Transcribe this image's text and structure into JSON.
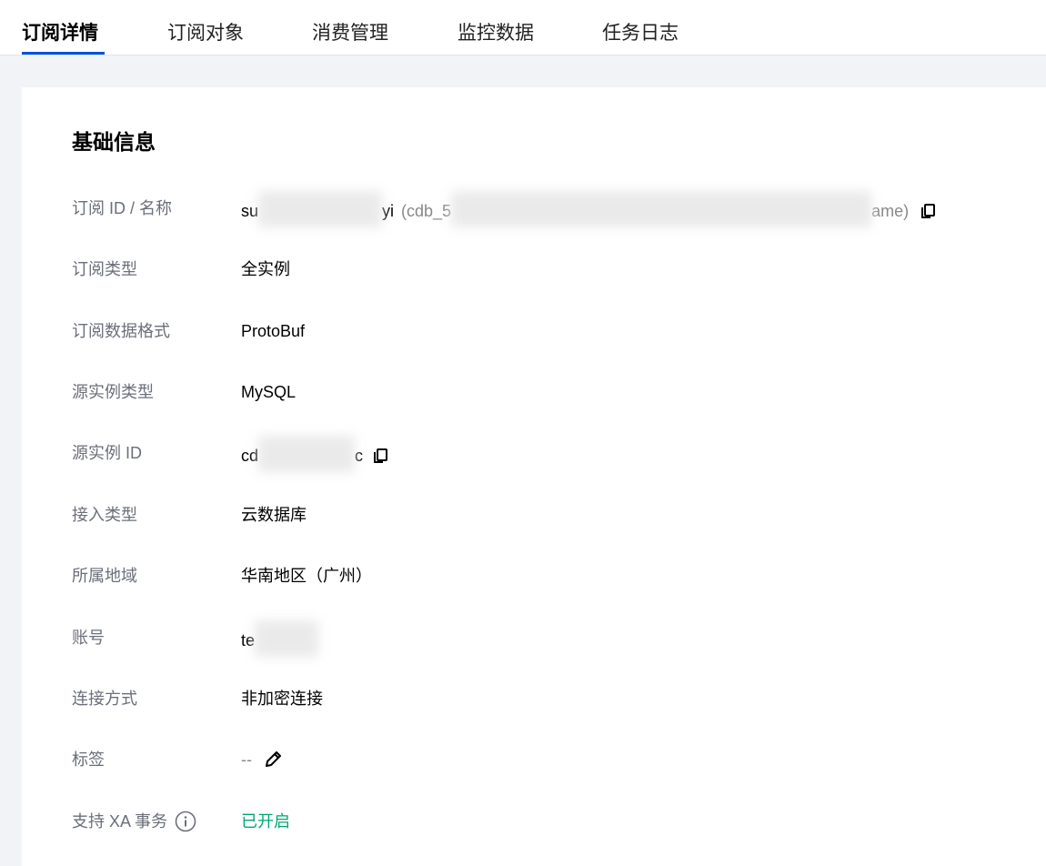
{
  "tabs": [
    {
      "label": "订阅详情",
      "active": true
    },
    {
      "label": "订阅对象",
      "active": false
    },
    {
      "label": "消费管理",
      "active": false
    },
    {
      "label": "监控数据",
      "active": false
    },
    {
      "label": "任务日志",
      "active": false
    }
  ],
  "section": {
    "title": "基础信息"
  },
  "fields": {
    "subscription_id_name": {
      "label": "订阅 ID / 名称",
      "id_prefix": "su",
      "id_suffix": "yi",
      "name_open": "(cdb_5",
      "name_close": "ame)"
    },
    "subscription_type": {
      "label": "订阅类型",
      "value": "全实例"
    },
    "data_format": {
      "label": "订阅数据格式",
      "value": "ProtoBuf"
    },
    "source_instance_type": {
      "label": "源实例类型",
      "value": "MySQL"
    },
    "source_instance_id": {
      "label": "源实例 ID",
      "prefix": "cd",
      "suffix": "c"
    },
    "access_type": {
      "label": "接入类型",
      "value": "云数据库"
    },
    "region": {
      "label": "所属地域",
      "value": "华南地区（广州）"
    },
    "account": {
      "label": "账号",
      "prefix": "te"
    },
    "connection_method": {
      "label": "连接方式",
      "value": "非加密连接"
    },
    "tags": {
      "label": "标签",
      "value": "--"
    },
    "xa_transaction": {
      "label": "支持 XA 事务",
      "value": "已开启"
    }
  },
  "icons": {
    "copy": "copy-icon",
    "edit": "edit-icon",
    "info": "info-icon"
  },
  "colors": {
    "accent": "#0052d9",
    "success": "#00a870",
    "label": "#6b6f7a"
  }
}
